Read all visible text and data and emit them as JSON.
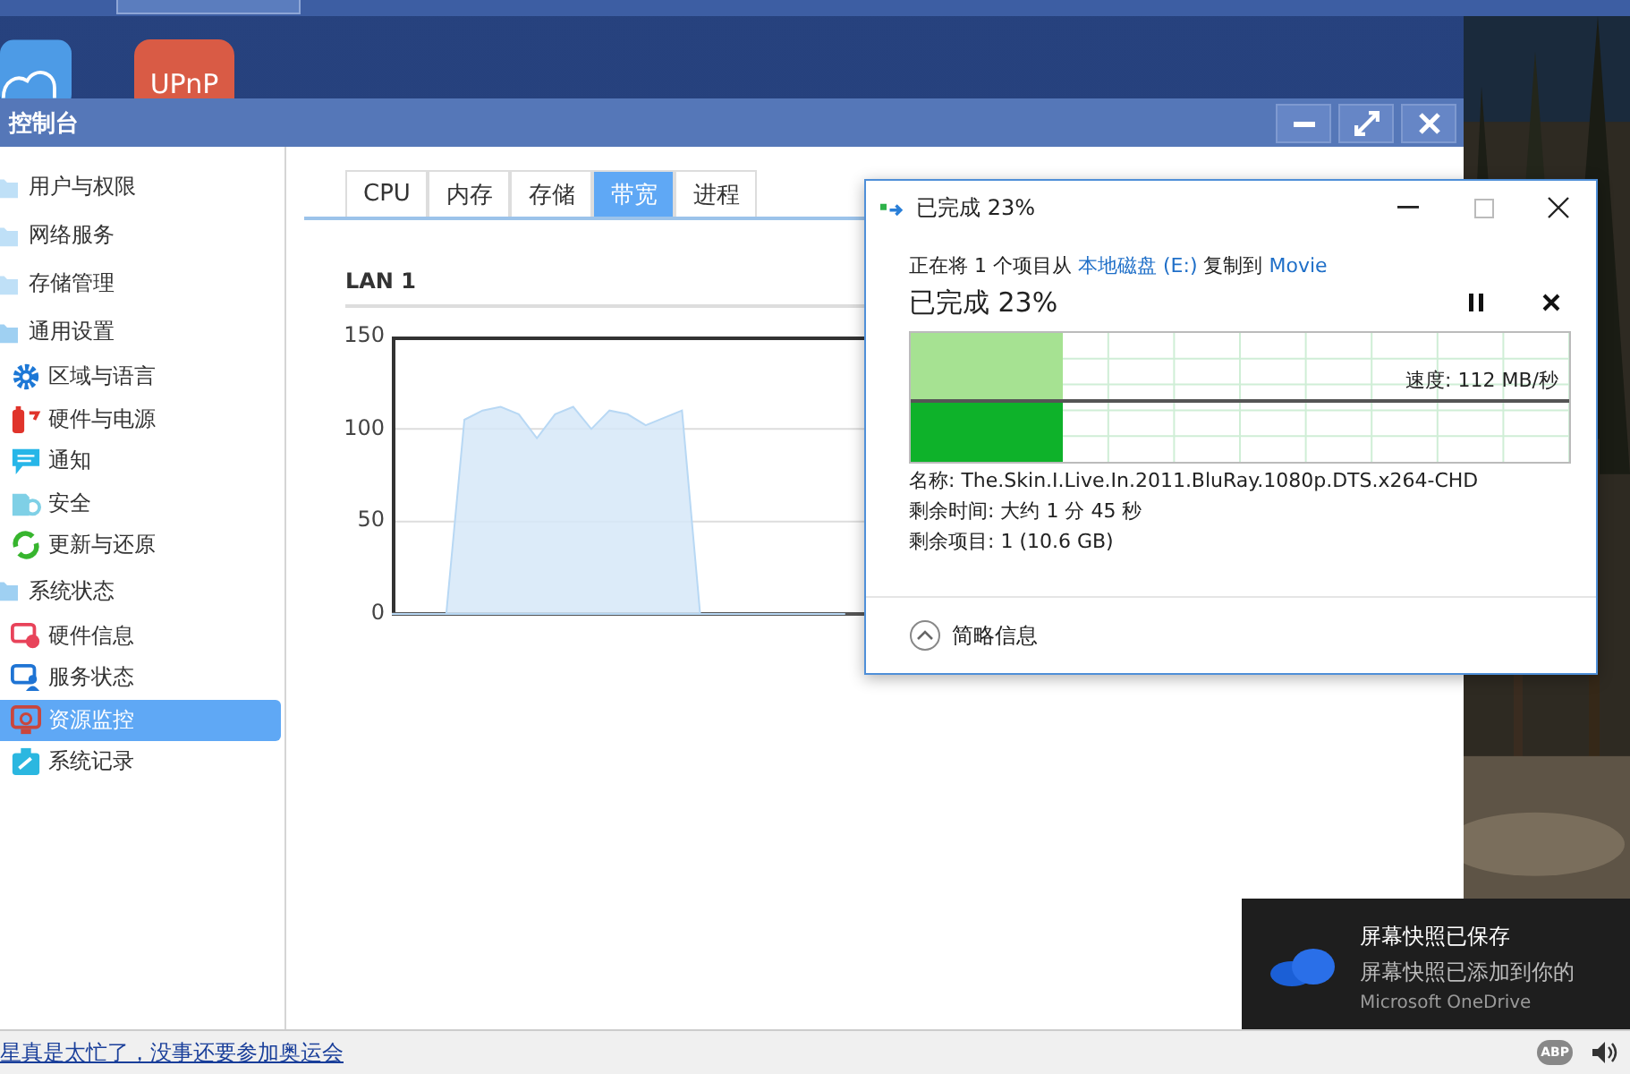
{
  "desktop": {
    "icons": [
      {
        "kind": "cloud"
      },
      {
        "kind": "upnp",
        "label": "UPnP"
      }
    ]
  },
  "window": {
    "title": "控制台"
  },
  "sidebar": {
    "items": [
      {
        "label": "用户与权限",
        "expanded": false
      },
      {
        "label": "网络服务",
        "expanded": false
      },
      {
        "label": "存储管理",
        "expanded": false
      },
      {
        "label": "通用设置",
        "expanded": true,
        "children": [
          {
            "label": "区域与语言",
            "selected": false
          },
          {
            "label": "硬件与电源",
            "selected": false
          },
          {
            "label": "通知",
            "selected": false
          },
          {
            "label": "安全",
            "selected": false
          },
          {
            "label": "更新与还原",
            "selected": false
          }
        ]
      },
      {
        "label": "系统状态",
        "expanded": true,
        "children": [
          {
            "label": "硬件信息",
            "selected": false
          },
          {
            "label": "服务状态",
            "selected": false
          },
          {
            "label": "资源监控",
            "selected": true
          },
          {
            "label": "系统记录",
            "selected": false
          }
        ]
      }
    ]
  },
  "tabs": [
    {
      "label": "CPU",
      "selected": false
    },
    {
      "label": "内存",
      "selected": false
    },
    {
      "label": "存储",
      "selected": false
    },
    {
      "label": "带宽",
      "selected": true
    },
    {
      "label": "进程",
      "selected": false
    }
  ],
  "panel": {
    "title": "LAN 1",
    "chart_data": {
      "type": "area",
      "ylim": [
        0,
        150
      ],
      "yticks": [
        0,
        50,
        100,
        150
      ],
      "series": [
        {
          "color": "#b8d8f4",
          "values": [
            0,
            0,
            0,
            0,
            105,
            110,
            112,
            108,
            95,
            108,
            112,
            100,
            110,
            108,
            102,
            106,
            110,
            0,
            0,
            0,
            0,
            0,
            0,
            0,
            0,
            0,
            null,
            null,
            null,
            null,
            null,
            null,
            null,
            null,
            null,
            null,
            null,
            null,
            null,
            null,
            null,
            null,
            null,
            null,
            null,
            null,
            null,
            null,
            null,
            null,
            null,
            null,
            null,
            null,
            null,
            null,
            null,
            null,
            null,
            null
          ]
        }
      ]
    }
  },
  "copy_dialog": {
    "title": "已完成 23%",
    "line": [
      {
        "kind": "text",
        "text": "正在将 1 个项目从 "
      },
      {
        "kind": "link",
        "text": "本地磁盘 (E:)"
      },
      {
        "kind": "text",
        "text": " 复制到 "
      },
      {
        "kind": "link",
        "text": "Movie"
      }
    ],
    "heading": "已完成 23%",
    "level": 0.23,
    "speed": "速度: 112 MB/秒",
    "details": [
      "名称: The.Skin.I.Live.In.2011.BluRay.1080p.DTS.x264-CHD",
      "剩余时间: 大约 1 分 45 秒",
      "剩余项目: 1 (10.6 GB)"
    ],
    "footer": "简略信息"
  },
  "toast": {
    "title": "屏幕快照已保存",
    "message": "屏幕快照已添加到你的",
    "source": "Microsoft OneDrive"
  },
  "status_bar": {
    "link": "星真是太忙了，没事还要参加奥运会",
    "adblock": "ABP"
  }
}
